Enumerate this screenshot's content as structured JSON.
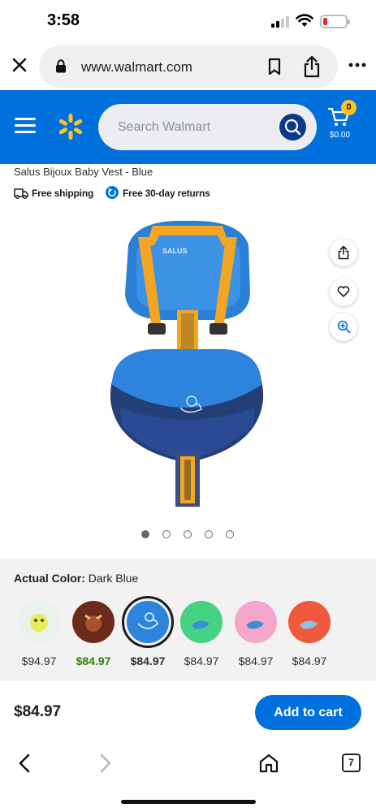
{
  "status_bar": {
    "time": "3:58"
  },
  "browser": {
    "url": "www.walmart.com",
    "tab_count": "7"
  },
  "header": {
    "search_placeholder": "Search Walmart",
    "cart_count": "0",
    "cart_total": "$0.00",
    "brand_color": "#0071dc",
    "spark_color": "#ffc220"
  },
  "product": {
    "title": "Salus Bijoux Baby Vest - Blue",
    "free_shipping": "Free shipping",
    "free_returns": "Free 30-day returns",
    "image_dots": 5,
    "active_dot": 0,
    "image_brand": "SALUS"
  },
  "color_picker": {
    "label": "Actual Color:",
    "selected": "Dark Blue",
    "options": [
      {
        "price": "$94.97"
      },
      {
        "price": "$84.97"
      },
      {
        "price": "$84.97"
      },
      {
        "price": "$84.97"
      },
      {
        "price": "$84.97"
      },
      {
        "price": "$84.97"
      }
    ]
  },
  "purchase": {
    "price": "$84.97",
    "add_to_cart_label": "Add to cart"
  },
  "icons": [
    "close-icon",
    "lock-icon",
    "bookmark-icon",
    "share-icon",
    "more-icon",
    "menu-icon",
    "spark-icon",
    "search-icon",
    "cart-icon",
    "truck-icon",
    "return-icon",
    "heart-icon",
    "zoom-icon",
    "back-icon",
    "forward-icon",
    "home-icon",
    "tabs-icon"
  ]
}
